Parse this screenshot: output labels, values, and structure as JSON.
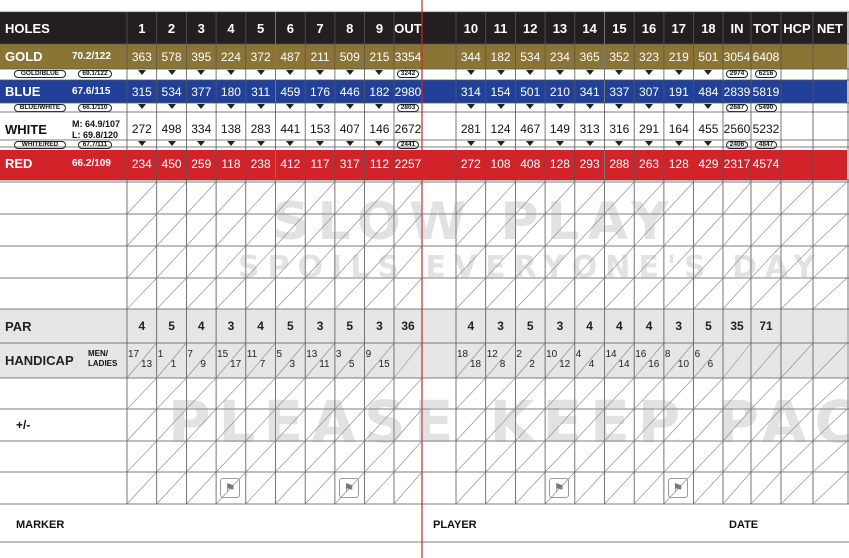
{
  "header": {
    "holes_label": "HOLES",
    "holes_front": [
      "1",
      "2",
      "3",
      "4",
      "5",
      "6",
      "7",
      "8",
      "9"
    ],
    "out_label": "OUT",
    "holes_back": [
      "10",
      "11",
      "12",
      "13",
      "14",
      "15",
      "16",
      "17",
      "18"
    ],
    "in_label": "IN",
    "tot_label": "TOT",
    "hcp_label": "HCP",
    "net_label": "NET"
  },
  "tees": [
    {
      "key": "gold",
      "name": "GOLD",
      "rating": "70.2/122",
      "front": [
        "363",
        "578",
        "395",
        "224",
        "372",
        "487",
        "211",
        "509",
        "215"
      ],
      "out": "3354",
      "back": [
        "344",
        "182",
        "534",
        "234",
        "365",
        "352",
        "323",
        "219",
        "501"
      ],
      "in": "3054",
      "tot": "6408",
      "color": "#8b7536"
    },
    {
      "key": "blue",
      "name": "BLUE",
      "rating": "67.6/115",
      "front": [
        "315",
        "534",
        "377",
        "180",
        "311",
        "459",
        "176",
        "446",
        "182"
      ],
      "out": "2980",
      "back": [
        "314",
        "154",
        "501",
        "210",
        "341",
        "337",
        "307",
        "191",
        "484"
      ],
      "in": "2839",
      "tot": "5819",
      "color": "#21409a"
    },
    {
      "key": "white",
      "name": "WHITE",
      "rating_m": "M: 64.9/107",
      "rating_l": "L: 69.8/120",
      "front": [
        "272",
        "498",
        "334",
        "138",
        "283",
        "441",
        "153",
        "407",
        "146"
      ],
      "out": "2672",
      "back": [
        "281",
        "124",
        "467",
        "149",
        "313",
        "316",
        "291",
        "164",
        "455"
      ],
      "in": "2560",
      "tot": "5232",
      "color": "#ffffff"
    },
    {
      "key": "red",
      "name": "RED",
      "rating": "66.2/109",
      "front": [
        "234",
        "450",
        "259",
        "118",
        "238",
        "412",
        "117",
        "317",
        "112"
      ],
      "out": "2257",
      "back": [
        "272",
        "108",
        "408",
        "128",
        "293",
        "288",
        "263",
        "128",
        "429"
      ],
      "in": "2317",
      "tot": "4574",
      "color": "#d2232a"
    }
  ],
  "combos": [
    {
      "name": "GOLD/BLUE",
      "rating": "69.1/122",
      "out": "3242",
      "in": "2974",
      "tot": "6216"
    },
    {
      "name": "BLUE/WHITE",
      "rating": "66.1/110",
      "out": "2803",
      "in": "2687",
      "tot": "5490"
    },
    {
      "name": "WHITE/RED",
      "rating": "67.7/111",
      "out": "2441",
      "in": "2406",
      "tot": "4847"
    }
  ],
  "par": {
    "label": "PAR",
    "front": [
      "4",
      "5",
      "4",
      "3",
      "4",
      "5",
      "3",
      "5",
      "3"
    ],
    "out": "36",
    "back": [
      "4",
      "3",
      "5",
      "3",
      "4",
      "4",
      "4",
      "3",
      "5"
    ],
    "in": "35",
    "tot": "71"
  },
  "handicap": {
    "label": "HANDICAP",
    "sub_men": "MEN/",
    "sub_ladies": "LADIES",
    "front_men": [
      "17",
      "1",
      "7",
      "15",
      "11",
      "5",
      "13",
      "3",
      "9"
    ],
    "front_ladies": [
      "13",
      "1",
      "9",
      "17",
      "7",
      "3",
      "11",
      "5",
      "15"
    ],
    "back_men": [
      "18",
      "12",
      "2",
      "10",
      "4",
      "14",
      "16",
      "8",
      "6"
    ],
    "back_ladies": [
      "18",
      "8",
      "2",
      "12",
      "4",
      "14",
      "16",
      "10",
      "6"
    ]
  },
  "plusminus_label": "+/-",
  "footer": {
    "marker": "MARKER",
    "player": "PLAYER",
    "date": "DATE"
  },
  "watermarks": {
    "slow_play": "SLOW PLAY",
    "spoils": "SPOILS EVERYONE'S DAY",
    "keep_pace": "PLEASE KEEP PACE"
  },
  "icons": [
    "walker-icon",
    "walker-icon",
    "walker-icon",
    "walker-icon"
  ]
}
